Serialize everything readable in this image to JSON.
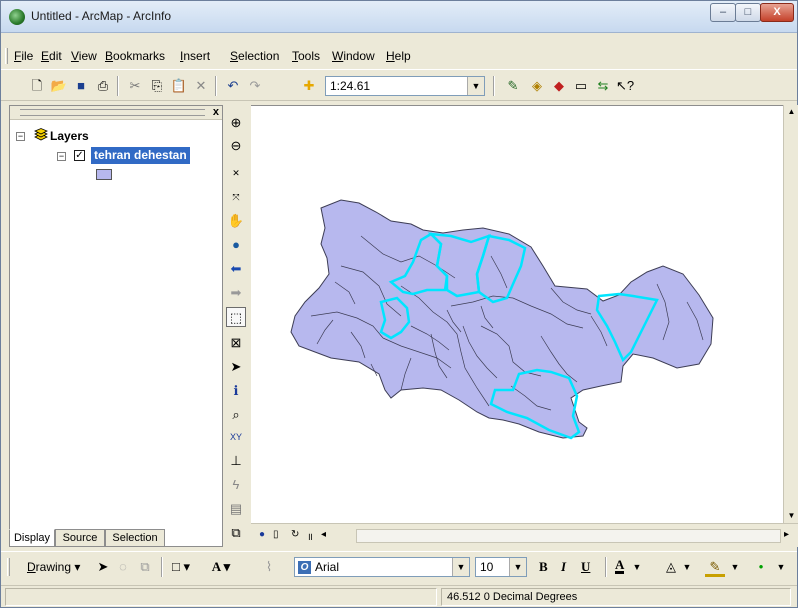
{
  "window": {
    "title": "Untitled - ArcMap - ArcInfo",
    "min": "–",
    "max": "□",
    "close": "X"
  },
  "menu": {
    "items": [
      {
        "accel": "F",
        "rest": "ile"
      },
      {
        "accel": "E",
        "rest": "dit"
      },
      {
        "accel": "V",
        "rest": "iew"
      },
      {
        "accel": "B",
        "rest": "ookmarks"
      },
      {
        "accel": "I",
        "rest": "nsert"
      },
      {
        "accel": "S",
        "rest": "election"
      },
      {
        "accel": "T",
        "rest": "ools"
      },
      {
        "accel": "W",
        "rest": "indow"
      },
      {
        "accel": "H",
        "rest": "elp"
      }
    ]
  },
  "toolbar": {
    "scale": "1:24.61"
  },
  "toc": {
    "root_label": "Layers",
    "layer_name": "tehran dehestan",
    "close": "x",
    "tabs": [
      "Display",
      "Source",
      "Selection"
    ]
  },
  "draw": {
    "accel": "D",
    "rest": "rawing",
    "font": "Arial",
    "font_size": "10",
    "bold": "B",
    "italic": "I",
    "underline": "U",
    "font_color": "A"
  },
  "status": {
    "coords": "46.512  0 Decimal Degrees"
  },
  "colors": {
    "fill": "#b7b8ee",
    "selection": "#00e5ff",
    "boundary": "#3d3d55",
    "toc_highlight": "#316ac5"
  }
}
